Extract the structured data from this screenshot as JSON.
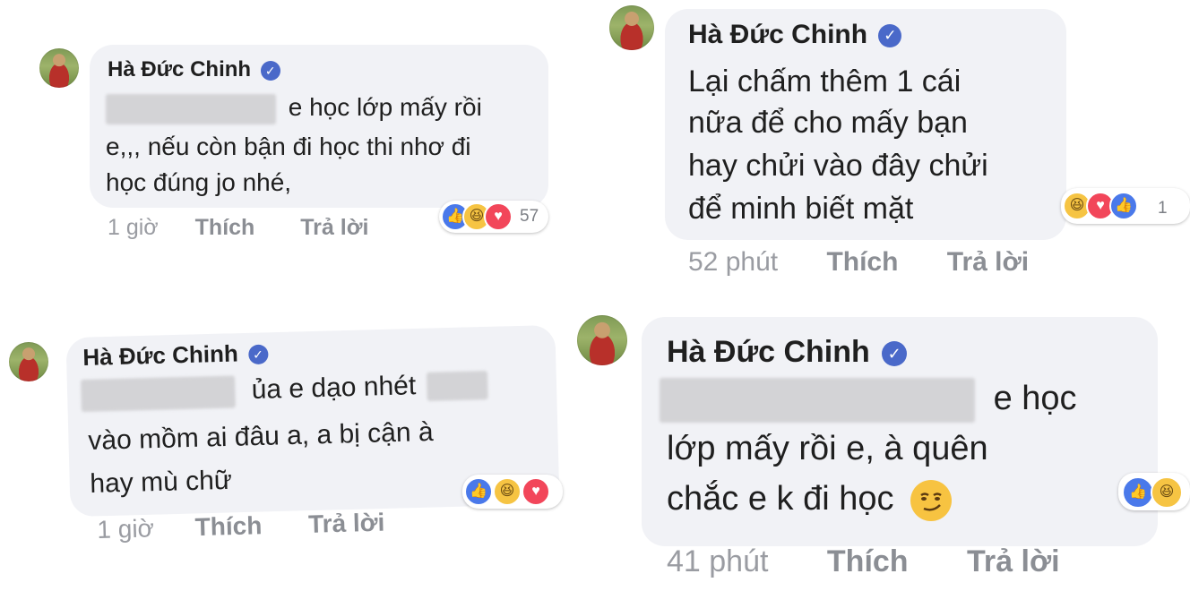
{
  "comments": [
    {
      "author": "Hà Đức Chinh",
      "lines": [
        "e học lớp mấy rồi",
        "e,,, nếu còn bận đi học thi nhơ đi",
        "học đúng jo nhé,"
      ],
      "time": "1 giờ",
      "like": "Thích",
      "reply": "Trả lời",
      "reaction_count": "57"
    },
    {
      "author": "Hà Đức Chinh",
      "lines": [
        "Lại chấm thêm 1 cái",
        "nữa để cho mấy bạn",
        "hay chửi vào đây chửi",
        "để minh biết mặt"
      ],
      "time": "52 phút",
      "like": "Thích",
      "reply": "Trả lời",
      "reaction_count": "1"
    },
    {
      "author": "Hà Đức Chinh",
      "lines": [
        "ủa e dạo nhét",
        "vào mồm ai đâu a, a bị cận à",
        "hay mù chữ"
      ],
      "time": "1 giờ",
      "like": "Thích",
      "reply": "Trả lời",
      "reaction_count": ""
    },
    {
      "author": "Hà Đức Chinh",
      "lines": [
        "e học",
        "lớp mấy rồi e, à quên",
        "chắc e k đi học"
      ],
      "time": "41 phút",
      "like": "Thích",
      "reply": "Trả lời",
      "reaction_count": ""
    }
  ],
  "icons": {
    "verified": "check-badge-icon",
    "like": "thumbs-up-icon",
    "haha": "laughing-face-icon",
    "love": "heart-icon",
    "smirk": "smirking-face-emoji"
  },
  "colors": {
    "bubble": "#f1f2f6",
    "verified_badge": "#4a69c9",
    "like_reaction": "#4a79ea",
    "love_reaction": "#f2465a",
    "haha_reaction": "#f6c443",
    "meta_text": "#8d9199"
  }
}
